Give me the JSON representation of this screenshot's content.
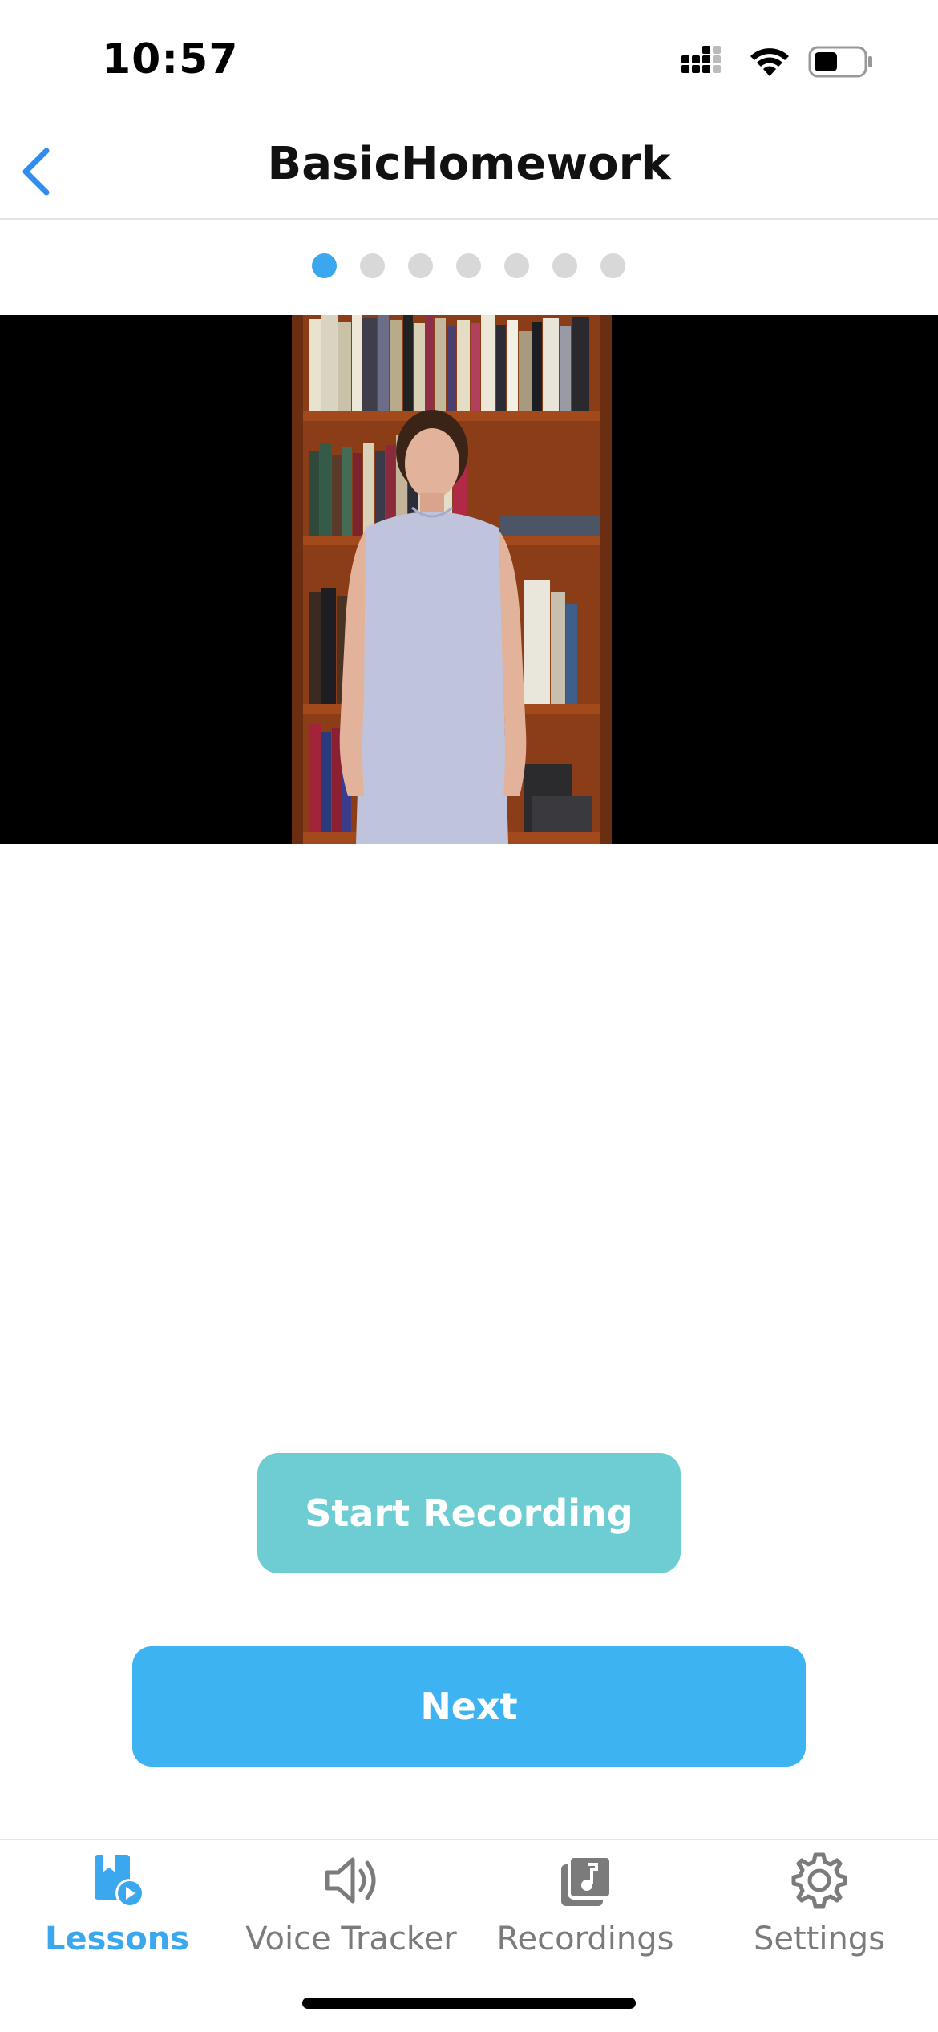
{
  "status_bar": {
    "time": "10:57"
  },
  "nav": {
    "title": "BasicHomework",
    "back_icon": "chevron-left-icon"
  },
  "pager": {
    "total": 7,
    "current": 1
  },
  "video": {
    "description_icon": "video-player"
  },
  "actions": {
    "record_label": "Start Recording",
    "next_label": "Next"
  },
  "tabs": [
    {
      "label": "Lessons",
      "icon": "lessons-icon",
      "active": true
    },
    {
      "label": "Voice Tracker",
      "icon": "speaker-icon",
      "active": false
    },
    {
      "label": "Recordings",
      "icon": "music-library-icon",
      "active": false
    },
    {
      "label": "Settings",
      "icon": "gear-icon",
      "active": false
    }
  ],
  "colors": {
    "accent": "#3aa7ee",
    "record": "#6dcdd3",
    "next": "#3db3f2"
  }
}
